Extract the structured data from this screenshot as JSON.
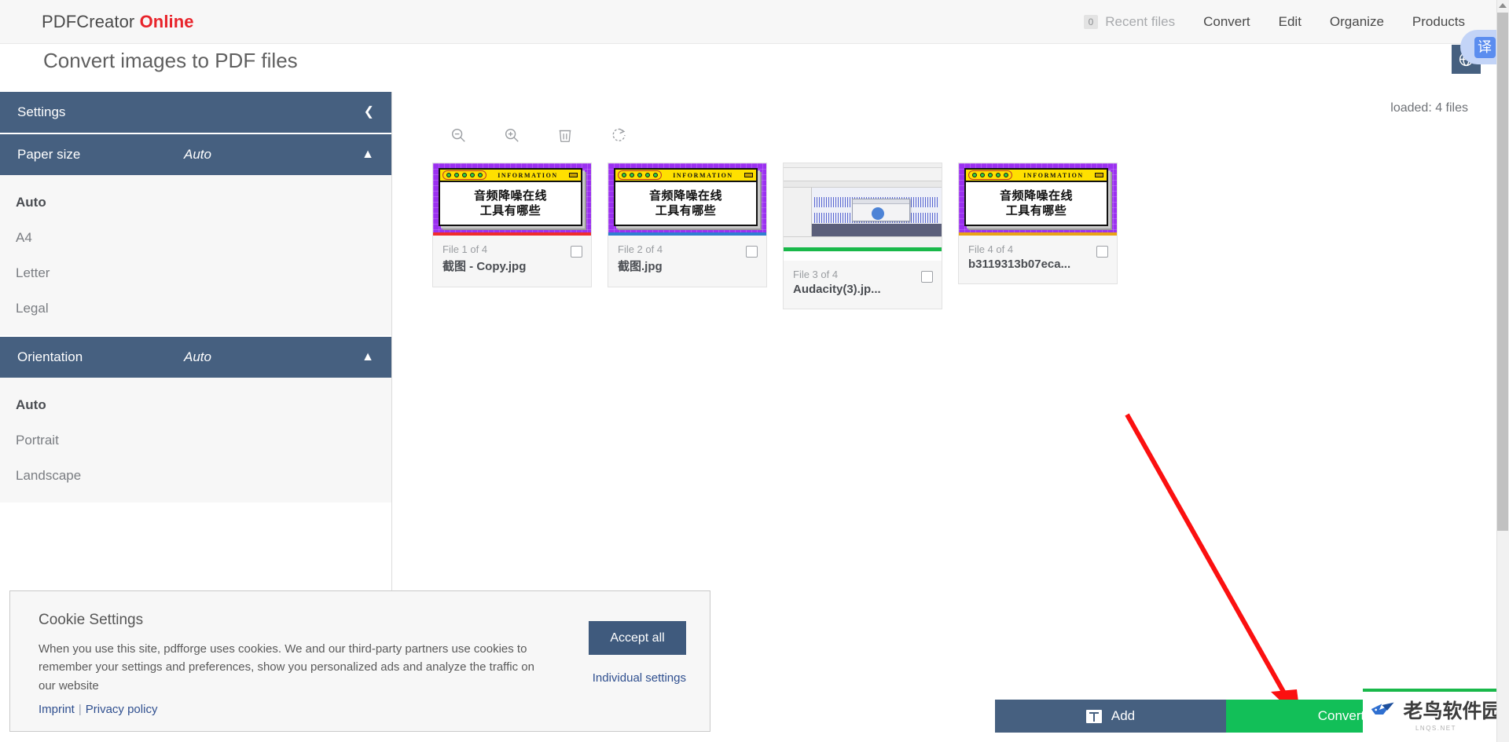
{
  "brand": {
    "name": "PDFCreator",
    "suffix": "Online"
  },
  "nav": {
    "recent_badge": "0",
    "items": [
      {
        "label": "Recent files",
        "muted": true
      },
      {
        "label": "Convert",
        "muted": false
      },
      {
        "label": "Edit",
        "muted": false
      },
      {
        "label": "Organize",
        "muted": false
      },
      {
        "label": "Products",
        "muted": false
      }
    ]
  },
  "page_title": "Convert images to PDF files",
  "translate": {
    "glyph": "译"
  },
  "sidebar": {
    "header": "Settings",
    "collapse_icon": "chevron-left-icon",
    "sections": [
      {
        "title": "Paper size",
        "value": "Auto",
        "options": [
          "Auto",
          "A4",
          "Letter",
          "Legal"
        ],
        "selected": "Auto"
      },
      {
        "title": "Orientation",
        "value": "Auto",
        "options": [
          "Auto",
          "Portrait",
          "Landscape"
        ],
        "selected": "Auto"
      }
    ]
  },
  "main": {
    "loaded_text": "loaded: 4 files",
    "tools": [
      {
        "name": "zoom-out-icon"
      },
      {
        "name": "zoom-in-icon"
      },
      {
        "name": "delete-icon"
      },
      {
        "name": "rotate-icon"
      }
    ],
    "files": [
      {
        "index": "File 1 of 4",
        "name": "截图 - Copy.jpg",
        "thumb": "poster",
        "accent": "#ef2d2d",
        "poster": {
          "title": "INFORMATION",
          "line1": "音频降噪在线",
          "line2": "工具有哪些"
        }
      },
      {
        "index": "File 2 of 4",
        "name": "截图.jpg",
        "thumb": "poster",
        "accent": "#2f7fd0",
        "poster": {
          "title": "INFORMATION",
          "line1": "音频降噪在线",
          "line2": "工具有哪些"
        }
      },
      {
        "index": "File 3 of 4",
        "name": "Audacity(3).jp...",
        "thumb": "audacity",
        "accent": "#19b84a",
        "poster": null
      },
      {
        "index": "File 4 of 4",
        "name": "b3119313b07eca...",
        "thumb": "poster",
        "accent": "#e8a317",
        "poster": {
          "title": "INFORMATION",
          "line1": "音频降噪在线",
          "line2": "工具有哪些"
        }
      }
    ]
  },
  "cookie": {
    "title": "Cookie Settings",
    "body": "When you use this site, pdfforge uses cookies. We and our third-party partners use cookies to remember your settings and preferences, show you personalized ads and analyze the traffic on our website",
    "imprint": "Imprint",
    "separator": "|",
    "privacy": "Privacy policy",
    "accept": "Accept all",
    "individual": "Individual settings"
  },
  "actions": {
    "add": "Add",
    "convert": "Convert"
  },
  "watermark": {
    "text": "老鸟软件园",
    "sub": "LNQS.NET"
  },
  "colors": {
    "panel_blue": "#466080",
    "convert_green": "#12bf58",
    "brand_red": "#e8232a",
    "arrow_red": "#fb1010"
  }
}
